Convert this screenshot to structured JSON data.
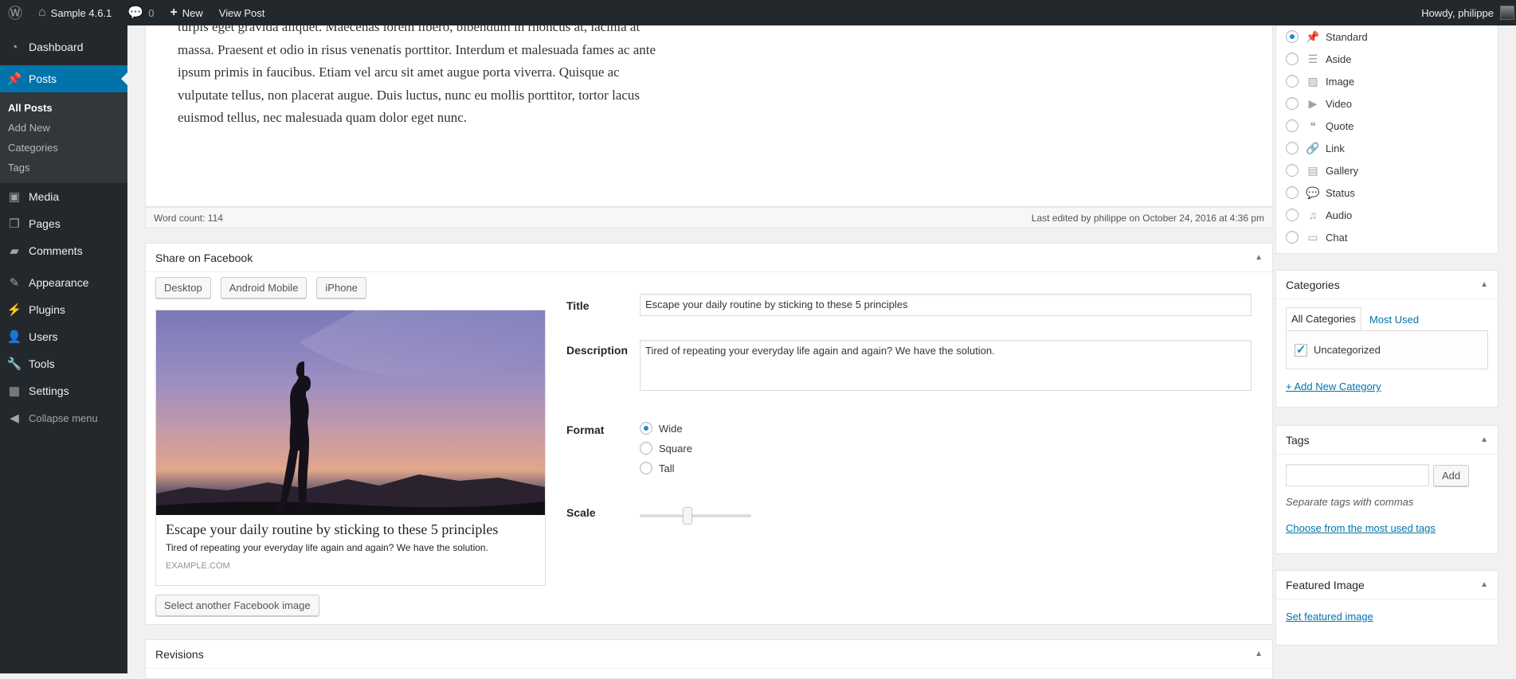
{
  "adminbar": {
    "site_name": "Sample 4.6.1",
    "comments_count": "0",
    "new_label": "New",
    "view_post": "View Post",
    "howdy": "Howdy, philippe"
  },
  "sidebar": {
    "items": [
      {
        "label": "Dashboard",
        "icon": "dashboard-icon"
      },
      {
        "label": "Posts",
        "icon": "pin-icon"
      },
      {
        "label": "Media",
        "icon": "media-icon"
      },
      {
        "label": "Pages",
        "icon": "pages-icon"
      },
      {
        "label": "Comments",
        "icon": "comment-icon"
      },
      {
        "label": "Appearance",
        "icon": "paintbrush-icon"
      },
      {
        "label": "Plugins",
        "icon": "plugin-icon"
      },
      {
        "label": "Users",
        "icon": "users-icon"
      },
      {
        "label": "Tools",
        "icon": "wrench-icon"
      },
      {
        "label": "Settings",
        "icon": "settings-icon"
      }
    ],
    "posts_submenu": [
      "All Posts",
      "Add New",
      "Categories",
      "Tags"
    ],
    "collapse": "Collapse menu"
  },
  "editor": {
    "body_text": "turpis eget gravida aliquet. Maecenas lorem libero, bibendum in rhoncus at, lacinia at massa. Praesent et odio in risus venenatis porttitor. Interdum et malesuada fames ac ante ipsum primis in faucibus. Etiam vel arcu sit amet augue porta viverra. Quisque ac vulputate tellus, non placerat augue. Duis luctus, nunc eu mollis porttitor, tortor lacus euismod tellus, nec malesuada quam dolor eget nunc.",
    "word_count": "Word count: 114",
    "last_edited": "Last edited by philippe on October 24, 2016 at 4:36 pm"
  },
  "facebook": {
    "title": "Share on Facebook",
    "devices": [
      "Desktop",
      "Android Mobile",
      "iPhone"
    ],
    "preview": {
      "headline": "Escape your daily routine by sticking to these 5 principles",
      "description": "Tired of repeating your everyday life again and again? We have the solution.",
      "domain": "EXAMPLE.COM"
    },
    "select_image": "Select another Facebook image",
    "labels": {
      "title": "Title",
      "description": "Description",
      "format": "Format",
      "scale": "Scale"
    },
    "title_value": "Escape your daily routine by sticking to these 5 principles",
    "description_value": "Tired of repeating your everyday life again and again? We have the solution.",
    "formats": [
      "Wide",
      "Square",
      "Tall"
    ],
    "selected_format": "Wide",
    "scale_fraction": 0.43
  },
  "revisions": {
    "title": "Revisions"
  },
  "format_box": {
    "options": [
      {
        "label": "Standard",
        "icon": "pin-icon"
      },
      {
        "label": "Aside",
        "icon": "aside-icon"
      },
      {
        "label": "Image",
        "icon": "image-icon"
      },
      {
        "label": "Video",
        "icon": "video-icon"
      },
      {
        "label": "Quote",
        "icon": "quote-icon"
      },
      {
        "label": "Link",
        "icon": "link-icon"
      },
      {
        "label": "Gallery",
        "icon": "gallery-icon"
      },
      {
        "label": "Status",
        "icon": "status-icon"
      },
      {
        "label": "Audio",
        "icon": "audio-icon"
      },
      {
        "label": "Chat",
        "icon": "chat-icon"
      }
    ],
    "selected": "Standard"
  },
  "categories": {
    "title": "Categories",
    "tab_all": "All Categories",
    "tab_most": "Most Used",
    "items": [
      "Uncategorized"
    ],
    "add_new": "+ Add New Category"
  },
  "tags": {
    "title": "Tags",
    "add_button": "Add",
    "hint": "Separate tags with commas",
    "choose": "Choose from the most used tags"
  },
  "featured": {
    "title": "Featured Image",
    "set": "Set featured image"
  },
  "colors": {
    "accent": "#0073aa",
    "adminbar": "#23282d"
  }
}
